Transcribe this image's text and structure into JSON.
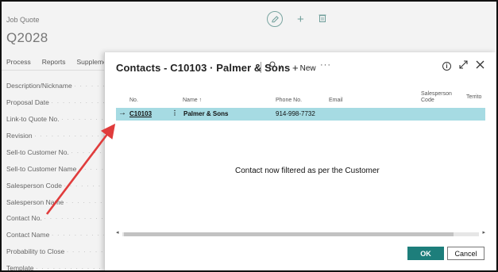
{
  "background_page": {
    "label": "Job Quote",
    "title": "Q2028",
    "actions": {
      "edit_icon": "pencil-icon",
      "add_icon": "plus-icon",
      "delete_icon": "trash-icon"
    },
    "menu": [
      "Process",
      "Reports",
      "Suppleme"
    ],
    "fields": [
      "Description/Nickname",
      "Proposal Date",
      "Link-to Quote No.",
      "Revision",
      "Sell-to Customer No.",
      "Sell-to Customer Name",
      "Salesperson Code",
      "Salesperson Name",
      "Contact No.",
      "Contact Name",
      "Probability to Close",
      "Template"
    ]
  },
  "dialog": {
    "title": "Contacts - C10103 · Palmer & Sons",
    "search_icon": "search-icon",
    "search_chevron": "∨",
    "new_label": "New",
    "more_label": "···",
    "columns": {
      "no": "No.",
      "name": "Name ↑",
      "phone": "Phone No.",
      "email": "Email",
      "salesperson_line1": "Salesperson",
      "salesperson_line2": "Code",
      "territory": "Territo"
    },
    "rows": [
      {
        "no": "C10103",
        "name": "Palmer & Sons",
        "phone": "914-998-7732"
      }
    ],
    "row_arrow": "→",
    "row_menu": "⋮",
    "annotation": "Contact now filtered as per the Customer",
    "ok_label": "OK",
    "cancel_label": "Cancel",
    "scroll_left": "◂",
    "scroll_right": "▸"
  },
  "colors": {
    "selected_row": "#a6dbe3",
    "ok_button": "#1d7e7b",
    "annotation_arrow": "#e03c3c"
  }
}
